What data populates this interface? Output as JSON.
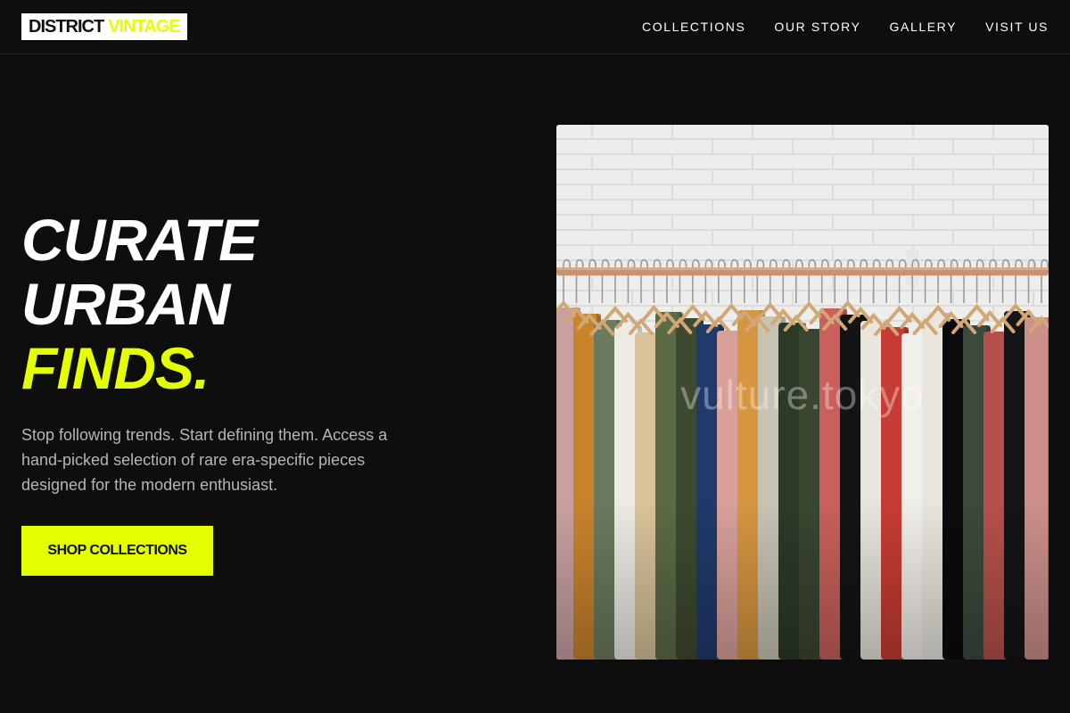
{
  "brand": {
    "part1": "DISTRICT",
    "part2": "VINTAGE",
    "accent_color": "#e4ff00"
  },
  "nav": {
    "items": [
      {
        "label": "COLLECTIONS"
      },
      {
        "label": "OUR STORY"
      },
      {
        "label": "GALLERY"
      },
      {
        "label": "VISIT US"
      }
    ]
  },
  "hero": {
    "headline_line1": "CURATE",
    "headline_line2": "URBAN",
    "headline_line3": "FINDS.",
    "description": "Stop following trends. Start defining them. Access a hand-picked selection of rare era-specific pieces designed for the modern enthusiast.",
    "cta_label": "SHOP COLLECTIONS"
  },
  "image": {
    "watermark": "vulture.tokyo",
    "garment_colors": [
      "#c9a0a0",
      "#c8832b",
      "#6b7a5e",
      "#ecebe6",
      "#d8c39a",
      "#5b6b45",
      "#3d4a2f",
      "#1f3a6b",
      "#d9a09a",
      "#d69640",
      "#c8c4b4",
      "#2c3a28",
      "#3a4630",
      "#c9605c",
      "#141414",
      "#e8e5dc",
      "#c63c34",
      "#f1efe9",
      "#e9e6de",
      "#0b0b0b",
      "#3b4a3c",
      "#b6504c",
      "#151515",
      "#cc8f8a"
    ]
  },
  "colors": {
    "background": "#0e0e0e",
    "text": "#ffffff",
    "muted": "#b5b5bd",
    "cta": "#e4ff00"
  }
}
